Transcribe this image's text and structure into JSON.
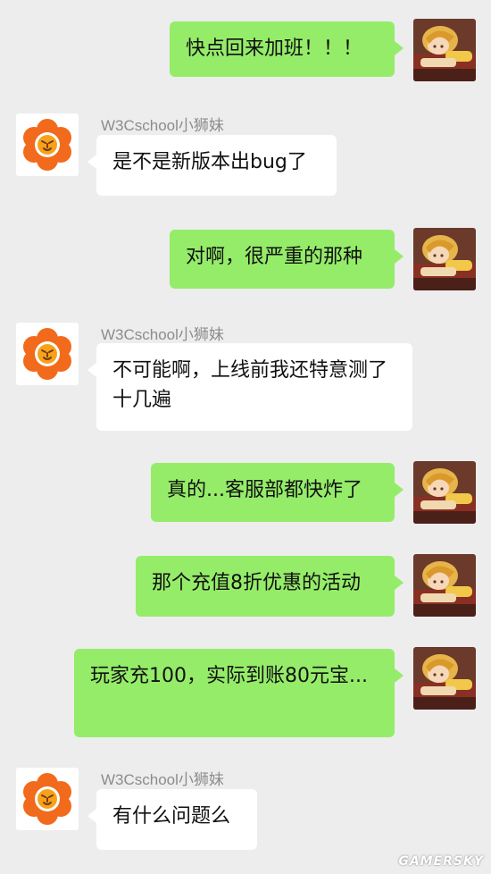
{
  "contact_name": "W3Cschool小狮妹",
  "colors": {
    "background": "#ededed",
    "my_bubble": "#95ec69",
    "their_bubble": "#ffffff",
    "name_text": "#8c8c8c",
    "logo_orange": "#f26a1b"
  },
  "icons": {
    "my_avatar": "anime-character-avatar",
    "their_avatar": "orange-lion-logo-avatar"
  },
  "messages": [
    {
      "sender": "me",
      "text": "快点回来加班！！！"
    },
    {
      "sender": "them",
      "name": "W3Cschool小狮妹",
      "text": "是不是新版本出bug了"
    },
    {
      "sender": "me",
      "text": "对啊，很严重的那种"
    },
    {
      "sender": "them",
      "name": "W3Cschool小狮妹",
      "text": "不可能啊，上线前我还特意测了十几遍"
    },
    {
      "sender": "me",
      "text": "真的...客服部都快炸了"
    },
    {
      "sender": "me",
      "text": "那个充值8折优惠的活动"
    },
    {
      "sender": "me",
      "text": "玩家充100，实际到账80元宝..."
    },
    {
      "sender": "them",
      "name": "W3Cschool小狮妹",
      "text": "有什么问题么"
    }
  ],
  "watermark": "GAMERSKY"
}
